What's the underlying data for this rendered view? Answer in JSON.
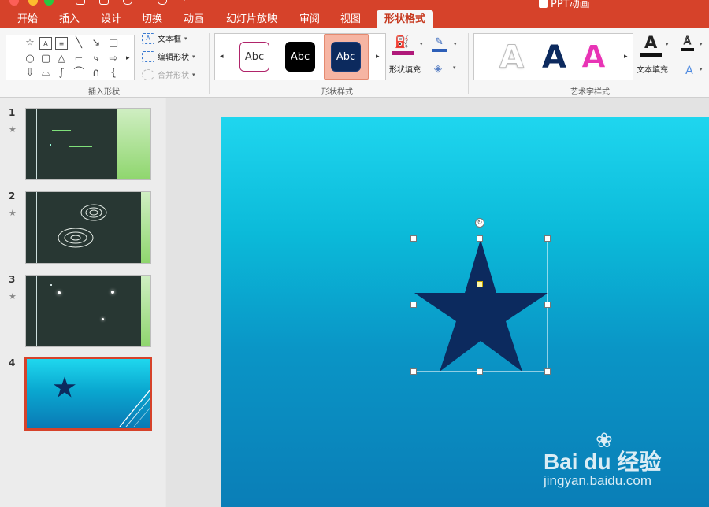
{
  "window": {
    "title": "PPT动画"
  },
  "tabs": [
    {
      "label": "开始"
    },
    {
      "label": "插入"
    },
    {
      "label": "设计"
    },
    {
      "label": "切换"
    },
    {
      "label": "动画"
    },
    {
      "label": "幻灯片放映"
    },
    {
      "label": "审阅"
    },
    {
      "label": "视图"
    },
    {
      "label": "形状格式",
      "active": true
    }
  ],
  "ribbon": {
    "insert_shapes": {
      "label": "插入形状",
      "text_box": "文本框",
      "edit_shape": "编辑形状",
      "merge_shapes": "合并形状"
    },
    "shape_styles": {
      "label": "形状样式",
      "presets": [
        {
          "text": "Abc",
          "fill": "#ffffff",
          "color": "#333333",
          "border": "#b0246a"
        },
        {
          "text": "Abc",
          "fill": "#000000",
          "color": "#ffffff",
          "border": "#000000"
        },
        {
          "text": "Abc",
          "fill": "#0c2a5e",
          "color": "#ffffff",
          "border": "#1a3d7a",
          "selected": true
        }
      ],
      "fill_label": "形状填充",
      "fill_color": "#b0197a"
    },
    "wordart": {
      "label": "艺术字样式",
      "letters": [
        {
          "text": "A",
          "style": "outline"
        },
        {
          "text": "A",
          "style": "navy"
        },
        {
          "text": "A",
          "style": "pink"
        }
      ],
      "text_fill_label": "文本填充"
    }
  },
  "slides": [
    {
      "number": "1",
      "theme": "dark"
    },
    {
      "number": "2",
      "theme": "dark"
    },
    {
      "number": "3",
      "theme": "dark"
    },
    {
      "number": "4",
      "theme": "blue",
      "selected": true
    }
  ],
  "canvas": {
    "shape": "star-icon",
    "shape_color": "#0c2a5e",
    "background_top": "#1fd6ef",
    "background_bottom": "#0a7eb7"
  },
  "watermark": {
    "brand": "Bai du 经验",
    "url": "jingyan.baidu.com"
  }
}
